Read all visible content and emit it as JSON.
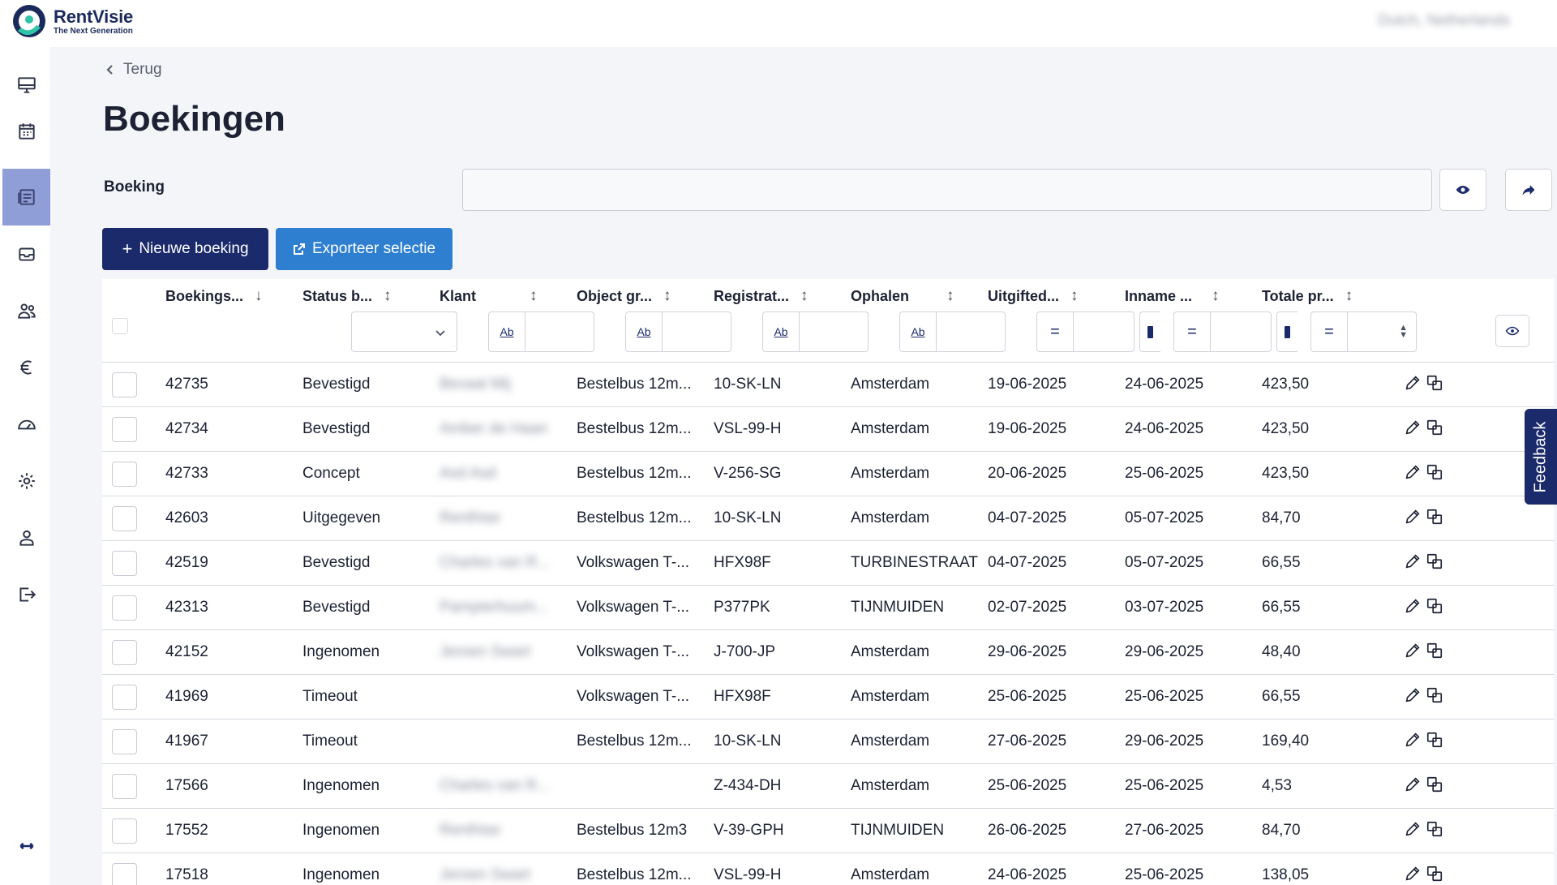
{
  "brand": {
    "name": "RentVisie",
    "tagline": "The Next Generation"
  },
  "topbar": {
    "location": "Dutch, Netherlands"
  },
  "sidebar": {
    "items": [
      {
        "name": "dashboard",
        "icon": "monitor-icon"
      },
      {
        "name": "calendar",
        "icon": "calendar-icon"
      },
      {
        "name": "bookings",
        "icon": "bookings-icon",
        "active": true
      },
      {
        "name": "inventory",
        "icon": "inbox-icon"
      },
      {
        "name": "customers",
        "icon": "users-icon"
      },
      {
        "name": "finance",
        "icon": "euro-icon"
      },
      {
        "name": "reports",
        "icon": "gauge-icon"
      },
      {
        "name": "settings",
        "icon": "gear-icon"
      },
      {
        "name": "account",
        "icon": "user-icon"
      },
      {
        "name": "logout",
        "icon": "logout-icon"
      }
    ],
    "collapse_icon": "expand-arrows-icon"
  },
  "page": {
    "back_label": "Terug",
    "title": "Boekingen",
    "search_label": "Boeking",
    "search_value": "",
    "new_button": "Nieuwe boeking",
    "export_button": "Exporteer selectie"
  },
  "table": {
    "columns": [
      {
        "key": "id",
        "label": "Boekings...",
        "sort": "↓"
      },
      {
        "key": "status",
        "label": "Status b...",
        "sort": "↕"
      },
      {
        "key": "klant",
        "label": "Klant",
        "sort": "↕"
      },
      {
        "key": "object",
        "label": "Object gr...",
        "sort": "↕"
      },
      {
        "key": "reg",
        "label": "Registrat...",
        "sort": "↕"
      },
      {
        "key": "ophalen",
        "label": "Ophalen",
        "sort": "↕"
      },
      {
        "key": "uitgifte",
        "label": "Uitgifted...",
        "sort": "↕"
      },
      {
        "key": "inname",
        "label": "Inname ...",
        "sort": "↕"
      },
      {
        "key": "totaal",
        "label": "Totale pr...",
        "sort": "↕"
      }
    ],
    "filter_text_label": "Ab",
    "filter_eq_label": "=",
    "rows": [
      {
        "id": "42735",
        "status": "Bevestigd",
        "klant": "Bevaal Mij",
        "object": "Bestelbus 12m...",
        "reg": "10-SK-LN",
        "ophalen": "Amsterdam",
        "uitgifte": "19-06-2025",
        "inname": "24-06-2025",
        "totaal": "423,50"
      },
      {
        "id": "42734",
        "status": "Bevestigd",
        "klant": "Amber de Haan",
        "object": "Bestelbus 12m...",
        "reg": "VSL-99-H",
        "ophalen": "Amsterdam",
        "uitgifte": "19-06-2025",
        "inname": "24-06-2025",
        "totaal": "423,50"
      },
      {
        "id": "42733",
        "status": "Concept",
        "klant": "Asd Asd",
        "object": "Bestelbus 12m...",
        "reg": "V-256-SG",
        "ophalen": "Amsterdam",
        "uitgifte": "20-06-2025",
        "inname": "25-06-2025",
        "totaal": "423,50"
      },
      {
        "id": "42603",
        "status": "Uitgegeven",
        "klant": "Renthise",
        "object": "Bestelbus 12m...",
        "reg": "10-SK-LN",
        "ophalen": "Amsterdam",
        "uitgifte": "04-07-2025",
        "inname": "05-07-2025",
        "totaal": "84,70"
      },
      {
        "id": "42519",
        "status": "Bevestigd",
        "klant": "Charles van R...",
        "object": "Volkswagen T-...",
        "reg": "HFX98F",
        "ophalen": "TURBINESTRAAT",
        "uitgifte": "04-07-2025",
        "inname": "05-07-2025",
        "totaal": "66,55"
      },
      {
        "id": "42313",
        "status": "Bevestigd",
        "klant": "Pampierhuum...",
        "object": "Volkswagen T-...",
        "reg": "P377PK",
        "ophalen": "TIJNMUIDEN",
        "uitgifte": "02-07-2025",
        "inname": "03-07-2025",
        "totaal": "66,55"
      },
      {
        "id": "42152",
        "status": "Ingenomen",
        "klant": "Jeroen Swart",
        "object": "Volkswagen T-...",
        "reg": "J-700-JP",
        "ophalen": "Amsterdam",
        "uitgifte": "29-06-2025",
        "inname": "29-06-2025",
        "totaal": "48,40"
      },
      {
        "id": "41969",
        "status": "Timeout",
        "klant": "",
        "object": "Volkswagen T-...",
        "reg": "HFX98F",
        "ophalen": "Amsterdam",
        "uitgifte": "25-06-2025",
        "inname": "25-06-2025",
        "totaal": "66,55"
      },
      {
        "id": "41967",
        "status": "Timeout",
        "klant": "",
        "object": "Bestelbus 12m...",
        "reg": "10-SK-LN",
        "ophalen": "Amsterdam",
        "uitgifte": "27-06-2025",
        "inname": "29-06-2025",
        "totaal": "169,40"
      },
      {
        "id": "17566",
        "status": "Ingenomen",
        "klant": "Charles van R...",
        "object": "",
        "reg": "Z-434-DH",
        "ophalen": "Amsterdam",
        "uitgifte": "25-06-2025",
        "inname": "25-06-2025",
        "totaal": "4,53"
      },
      {
        "id": "17552",
        "status": "Ingenomen",
        "klant": "Renthise",
        "object": "Bestelbus 12m3",
        "reg": "V-39-GPH",
        "ophalen": "TIJNMUIDEN",
        "uitgifte": "26-06-2025",
        "inname": "27-06-2025",
        "totaal": "84,70"
      },
      {
        "id": "17518",
        "status": "Ingenomen",
        "klant": "Jeroen Swart",
        "object": "Bestelbus 12m...",
        "reg": "VSL-99-H",
        "ophalen": "Amsterdam",
        "uitgifte": "24-06-2025",
        "inname": "25-06-2025",
        "totaal": "138,05"
      }
    ]
  },
  "feedback_label": "Feedback",
  "colors": {
    "primary": "#1b2a6b",
    "accent": "#2e7fd0",
    "sidebar_active": "#8f9ed6",
    "logo_teal": "#2ec4a5"
  }
}
